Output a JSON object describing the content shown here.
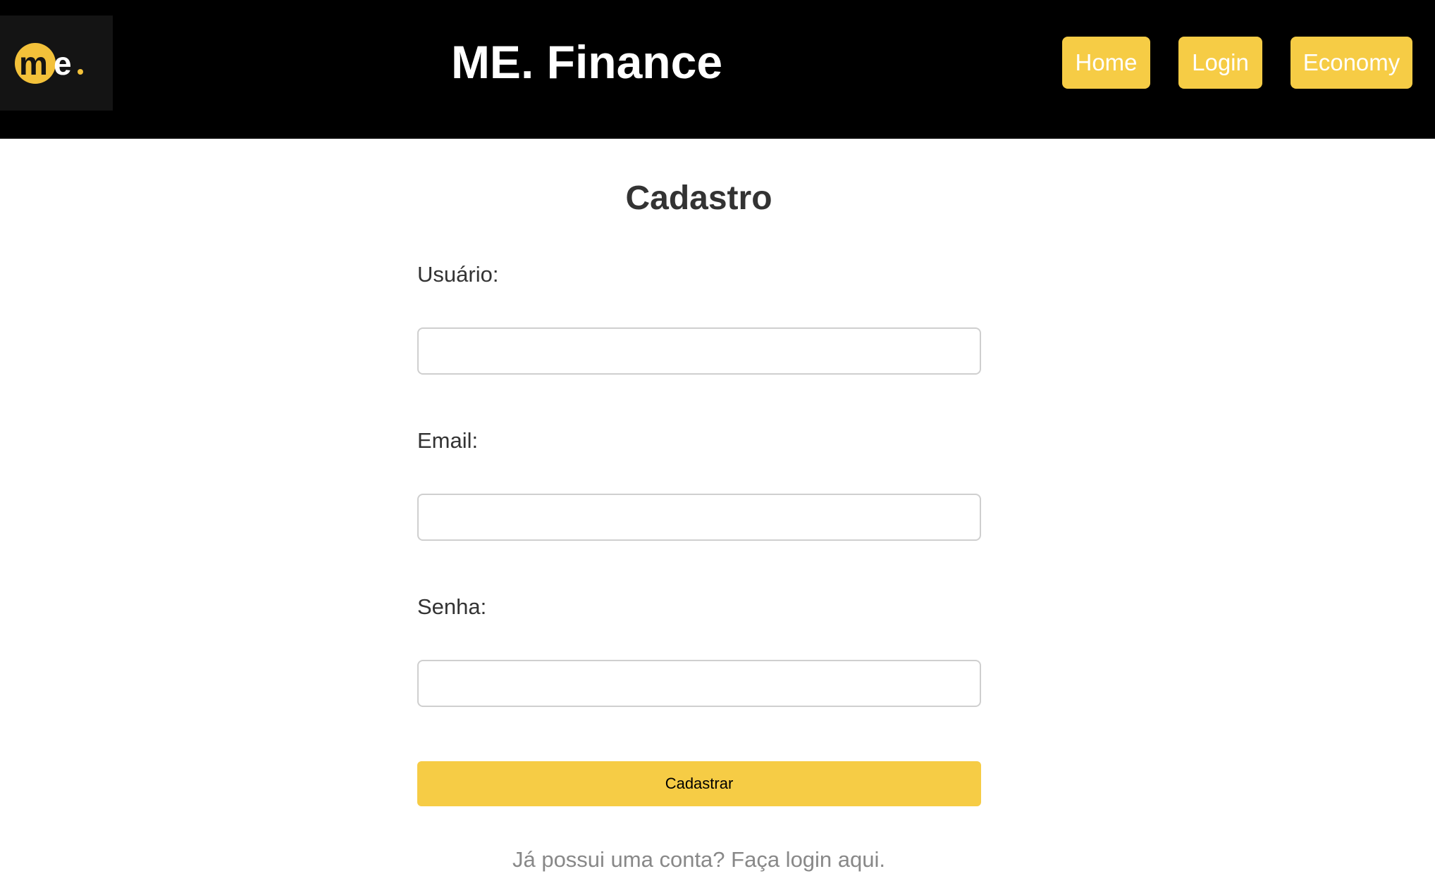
{
  "header": {
    "logo_text": "me.",
    "title": "ME. Finance",
    "nav": {
      "home": "Home",
      "login": "Login",
      "economy": "Economy"
    }
  },
  "form": {
    "title": "Cadastro",
    "username_label": "Usuário:",
    "username_value": "",
    "email_label": "Email:",
    "email_value": "",
    "password_label": "Senha:",
    "password_value": "",
    "submit_label": "Cadastrar",
    "login_link": "Já possui uma conta? Faça login aqui."
  },
  "colors": {
    "header_background": "#000000",
    "accent": "#f6cc45",
    "text": "#333333",
    "muted_text": "#888888"
  }
}
